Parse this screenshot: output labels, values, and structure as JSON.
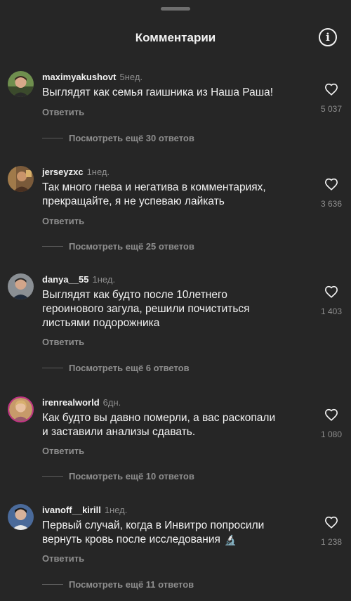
{
  "header": {
    "title": "Комментарии",
    "info_icon": "info-icon"
  },
  "comments": [
    {
      "username": "maximyakushovt",
      "time": "5нед.",
      "lines": [
        "Выглядят как семья гаишника из Наша Раша!"
      ],
      "reply_label": "Ответить",
      "likes": "5 037",
      "view_replies": "Посмотреть ещё 30 ответов",
      "avatar_color": "#6f8f4e"
    },
    {
      "username": "jerseyzxc",
      "time": "1нед.",
      "lines": [
        "Так много гнева и негатива в комментариях,",
        "прекращайте, я не успеваю лайкать"
      ],
      "reply_label": "Ответить",
      "likes": "3 636",
      "view_replies": "Посмотреть ещё 25 ответов",
      "avatar_color": "#7a5a3a"
    },
    {
      "username": "danya__55",
      "time": "1нед.",
      "lines": [
        "Выглядят как будто после 10летнего",
        "героинового загула, решили почиститься",
        "листьями подорожника"
      ],
      "reply_label": "Ответить",
      "likes": "1 403",
      "view_replies": "Посмотреть ещё 6 ответов",
      "avatar_color": "#8a8f94"
    },
    {
      "username": "irenrealworld",
      "time": "6дн.",
      "lines": [
        "Как будто вы давно померли, а вас раскопали",
        "и заставили анализы сдавать."
      ],
      "reply_label": "Ответить",
      "likes": "1 080",
      "view_replies": "Посмотреть ещё 10 ответов",
      "avatar_color": "#c79a6a"
    },
    {
      "username": "ivanoff__kirill",
      "time": "1нед.",
      "lines": [
        "Первый случай, когда в Инвитро попросили",
        "вернуть кровь после исследования"
      ],
      "emoji": "🔬",
      "reply_label": "Ответить",
      "likes": "1 238",
      "view_replies": "Посмотреть ещё 11 ответов",
      "avatar_color": "#4a6a9a"
    }
  ]
}
